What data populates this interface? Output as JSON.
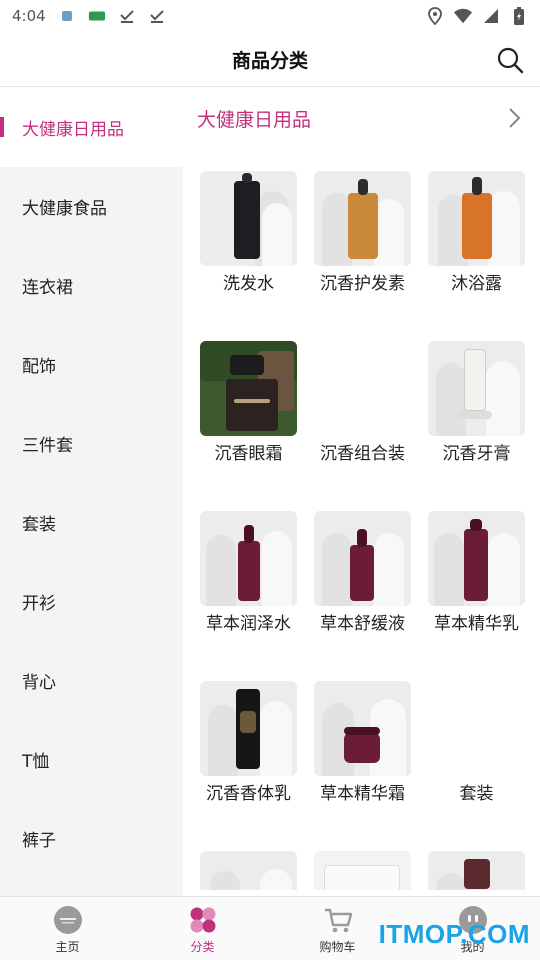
{
  "status_bar": {
    "time": "4:04"
  },
  "header": {
    "title": "商品分类"
  },
  "sidebar": {
    "items": [
      {
        "label": "大健康日用品",
        "active": true
      },
      {
        "label": "大健康食品"
      },
      {
        "label": "连衣裙"
      },
      {
        "label": "配饰"
      },
      {
        "label": "三件套"
      },
      {
        "label": "套装"
      },
      {
        "label": "开衫"
      },
      {
        "label": "背心"
      },
      {
        "label": "T恤"
      },
      {
        "label": "裤子"
      }
    ]
  },
  "main": {
    "category_title": "大健康日用品",
    "products": [
      {
        "label": "洗发水"
      },
      {
        "label": "沉香护发素"
      },
      {
        "label": "沐浴露"
      },
      {
        "label": "沉香眼霜"
      },
      {
        "label": "沉香组合装"
      },
      {
        "label": "沉香牙膏"
      },
      {
        "label": "草本润泽水"
      },
      {
        "label": "草本舒缓液"
      },
      {
        "label": "草本精华乳"
      },
      {
        "label": "沉香香体乳"
      },
      {
        "label": "草本精华霜"
      },
      {
        "label": "套装"
      },
      {
        "label": ""
      },
      {
        "label": ""
      },
      {
        "label": ""
      }
    ]
  },
  "tabbar": {
    "tabs": [
      {
        "label": "主页"
      },
      {
        "label": "分类",
        "active": true
      },
      {
        "label": "购物车"
      },
      {
        "label": "我的"
      }
    ]
  },
  "watermark": "ITMOP.COM",
  "colors": {
    "accent": "#c2317c",
    "sidebar_bg": "#f4f4f4",
    "watermark": "#1aa3e8"
  }
}
